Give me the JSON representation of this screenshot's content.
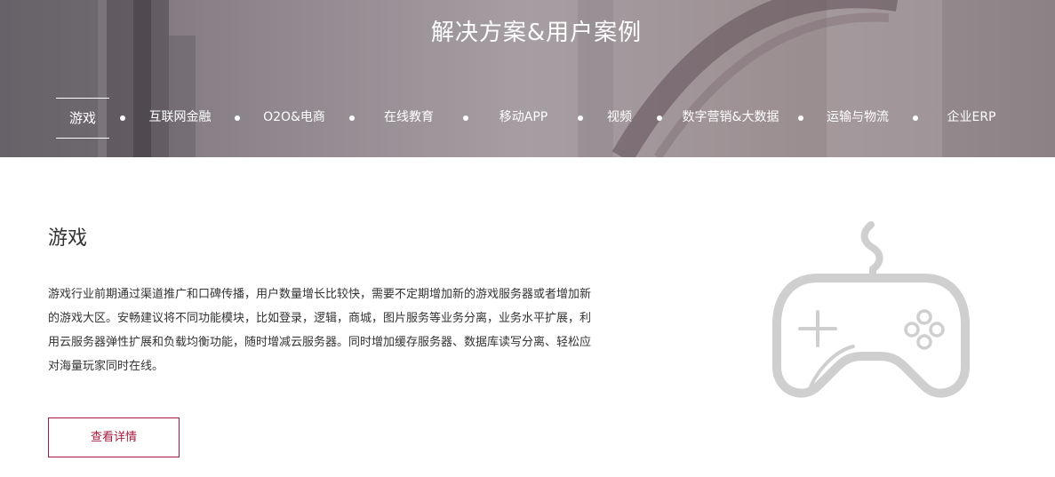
{
  "banner": {
    "title": "解决方案&用户案例"
  },
  "nav": {
    "items": [
      {
        "label": "游戏",
        "active": true
      },
      {
        "label": "互联网金融"
      },
      {
        "label": "O2O&电商"
      },
      {
        "label": "在线教育"
      },
      {
        "label": "移动APP"
      },
      {
        "label": "视频"
      },
      {
        "label": "数字营销&大数据"
      },
      {
        "label": "运输与物流"
      },
      {
        "label": "企业ERP"
      }
    ]
  },
  "content": {
    "title": "游戏",
    "description_lines": [
      "游戏行业前期通过渠道推广和口碑传播，用户数量增长比较快，需要不定期增加新的游戏服务器或者增加新",
      "的游戏大区。安畅建议将不同功能模块，比如登录，逻辑，商城，图片服务等业务分离，业务水平扩展，利",
      "用云服务器弹性扩展和负载均衡功能，随时增减云服务器。同时增加缓存服务器、数据库读写分离、轻松应",
      "对海量玩家同时在线。"
    ],
    "detail_button": "查看详情",
    "illustration_icon": "gamepad-icon"
  },
  "colors": {
    "accent": "#a5193c",
    "icon_gray": "#cfcfcf"
  }
}
